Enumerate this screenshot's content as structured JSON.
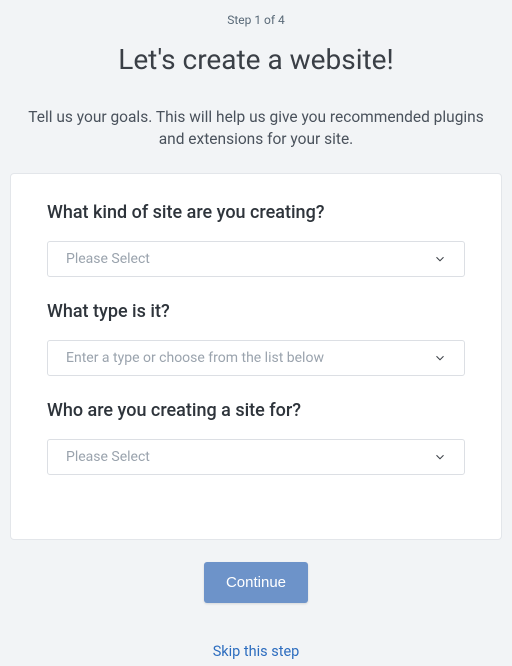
{
  "header": {
    "step_indicator": "Step 1 of 4",
    "title": "Let's create a website!",
    "subtitle": "Tell us your goals. This will help us give you recommended plugins and extensions for your site."
  },
  "form": {
    "fields": [
      {
        "label": "What kind of site are you creating?",
        "placeholder": "Please Select"
      },
      {
        "label": "What type is it?",
        "placeholder": "Enter a type or choose from the list below"
      },
      {
        "label": "Who are you creating a site for?",
        "placeholder": "Please Select"
      }
    ]
  },
  "actions": {
    "continue_label": "Continue",
    "skip_label": "Skip this step"
  }
}
